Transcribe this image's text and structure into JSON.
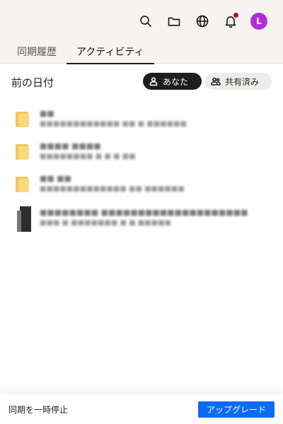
{
  "header": {
    "icons": [
      "search-icon",
      "folder-icon",
      "globe-icon",
      "bell-icon"
    ],
    "avatar_initial": "L",
    "avatar_color": "#b42bd6",
    "notification_dot_color": "#a8102e"
  },
  "tabs": [
    {
      "label": "同期履歴",
      "active": false
    },
    {
      "label": "アクティビティ",
      "active": true
    }
  ],
  "section": {
    "title": "前の日付",
    "filters": {
      "you": "あなた",
      "shared": "共有済み"
    }
  },
  "items": [
    {
      "type": "folder",
      "name": "■■",
      "detail": "■■■■■■■■■■■■ ■■ ■ ■■■■■■"
    },
    {
      "type": "folder",
      "name": "■■■■ ■■■■",
      "detail": "■■■■■■■■ ■ ■ ■ ■■"
    },
    {
      "type": "folder",
      "name": "■■ ■■",
      "detail": "■■■■■■■■■■■■■ ■■ ■■■■■■"
    },
    {
      "type": "document",
      "name": "■■■■■■■■ ■■■■■■■■■■■■■■■■■■■■",
      "detail": "■■■ ■ ■■■■■■■ ■ ■ ■■■■■"
    }
  ],
  "footer": {
    "pause_label": "同期を一時停止",
    "upgrade_label": "アップグレード",
    "upgrade_color": "#0b6bf5"
  }
}
